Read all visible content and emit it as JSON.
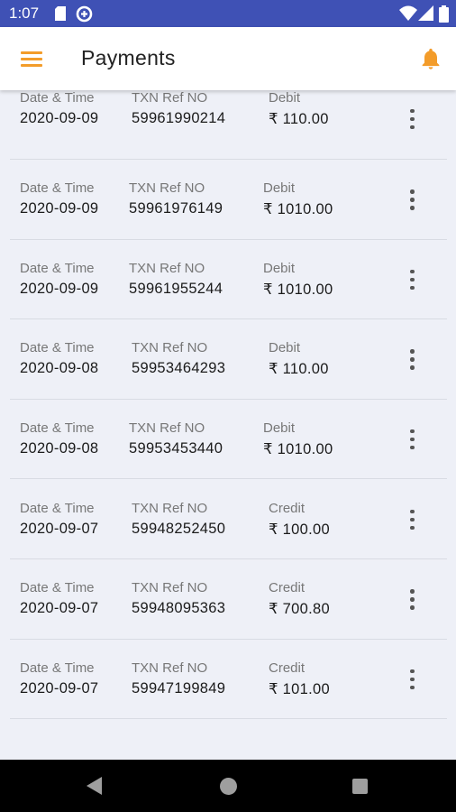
{
  "status_bar": {
    "time": "1:07",
    "icons": [
      "sd-card-icon",
      "data-saver-icon",
      "wifi-icon",
      "signal-icon",
      "battery-icon"
    ]
  },
  "app_bar": {
    "title": "Payments",
    "menu_icon": "hamburger-menu-icon",
    "notification_icon": "bell-icon"
  },
  "colors": {
    "status_bar": "#3f51b5",
    "accent": "#f39c2a",
    "background": "#eef0f7",
    "label": "#777777",
    "value": "#1b1b1b"
  },
  "columns": {
    "date": "Date & Time",
    "ref": "TXN Ref NO"
  },
  "transactions": [
    {
      "date": "2020-09-09",
      "ref": "59961990214",
      "type": "Debit",
      "amount": "₹ 110.00"
    },
    {
      "date": "2020-09-09",
      "ref": "59961976149",
      "type": "Debit",
      "amount": "₹ 1010.00"
    },
    {
      "date": "2020-09-09",
      "ref": "59961955244",
      "type": "Debit",
      "amount": "₹ 1010.00"
    },
    {
      "date": "2020-09-08",
      "ref": "59953464293",
      "type": "Debit",
      "amount": "₹ 110.00"
    },
    {
      "date": "2020-09-08",
      "ref": "59953453440",
      "type": "Debit",
      "amount": "₹ 1010.00"
    },
    {
      "date": "2020-09-07",
      "ref": "59948252450",
      "type": "Credit",
      "amount": "₹ 100.00"
    },
    {
      "date": "2020-09-07",
      "ref": "59948095363",
      "type": "Credit",
      "amount": "₹ 700.80"
    },
    {
      "date": "2020-09-07",
      "ref": "59947199849",
      "type": "Credit",
      "amount": "₹ 101.00"
    }
  ],
  "nav_bar": {
    "icons": [
      "back-icon",
      "home-icon",
      "recents-icon"
    ]
  }
}
